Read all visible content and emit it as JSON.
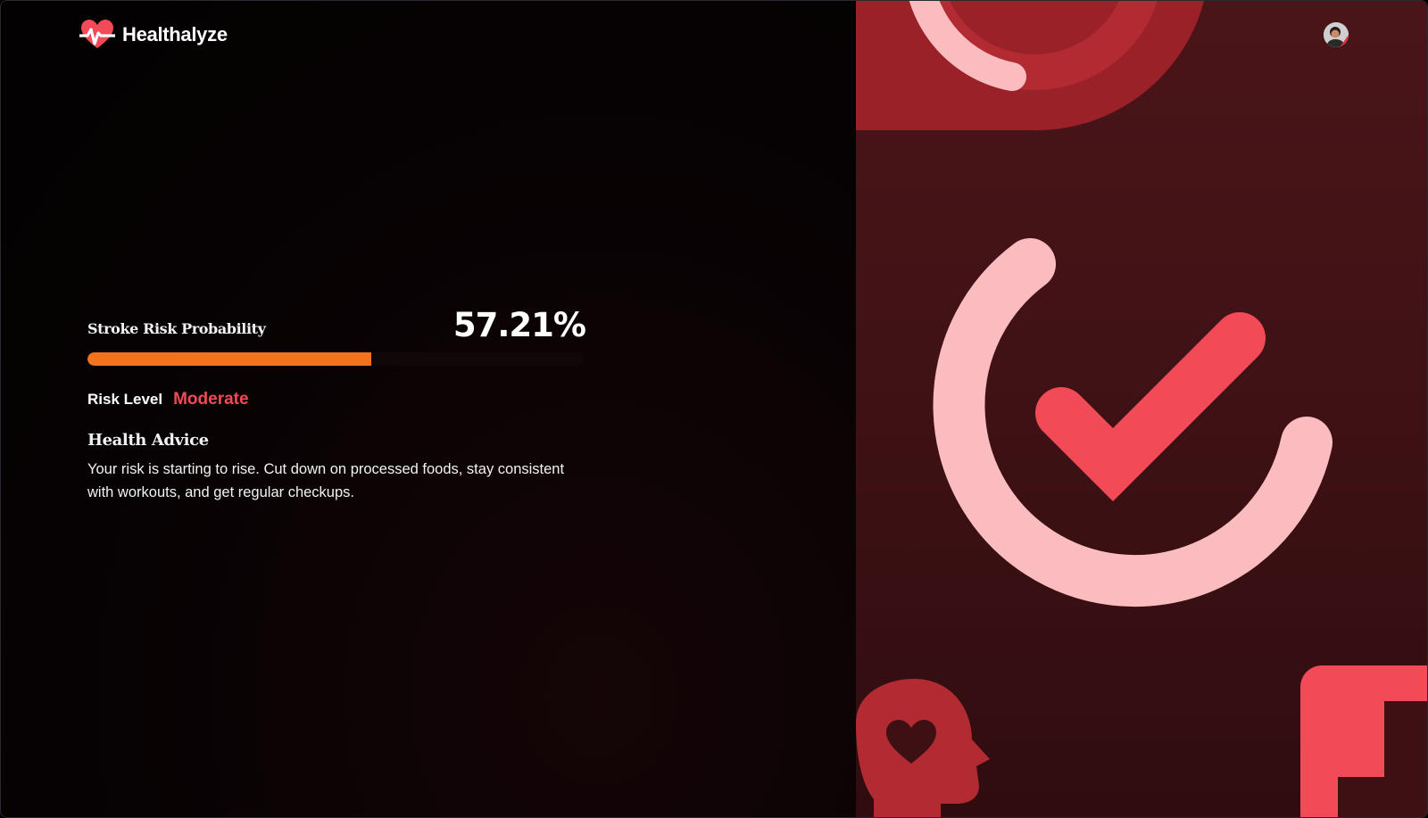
{
  "app": {
    "name": "Healthalyze"
  },
  "header": {
    "logo_icon": "heart-pulse-icon",
    "avatar_icon": "user-avatar"
  },
  "results": {
    "probability_label": "Stroke Risk Probability",
    "probability_value": "57.21%",
    "probability_fraction": 0.5721,
    "risk_level_label": "Risk Level",
    "risk_level_value": "Moderate",
    "advice_title": "Health Advice",
    "advice_text": "Your risk is starting to rise. Cut down on processed foods, stay consistent with workouts, and get regular checkups."
  },
  "illustration": {
    "icons": [
      "ring-icon",
      "checkmark-circle-icon",
      "head-heart-icon",
      "medical-cross-icon"
    ]
  },
  "colors": {
    "accent_red": "#f24a56",
    "progress_orange": "#f2731c",
    "panel_dark_red": "#3d1114",
    "pink": "#fbbcbf",
    "deep_red": "#9b2129"
  }
}
